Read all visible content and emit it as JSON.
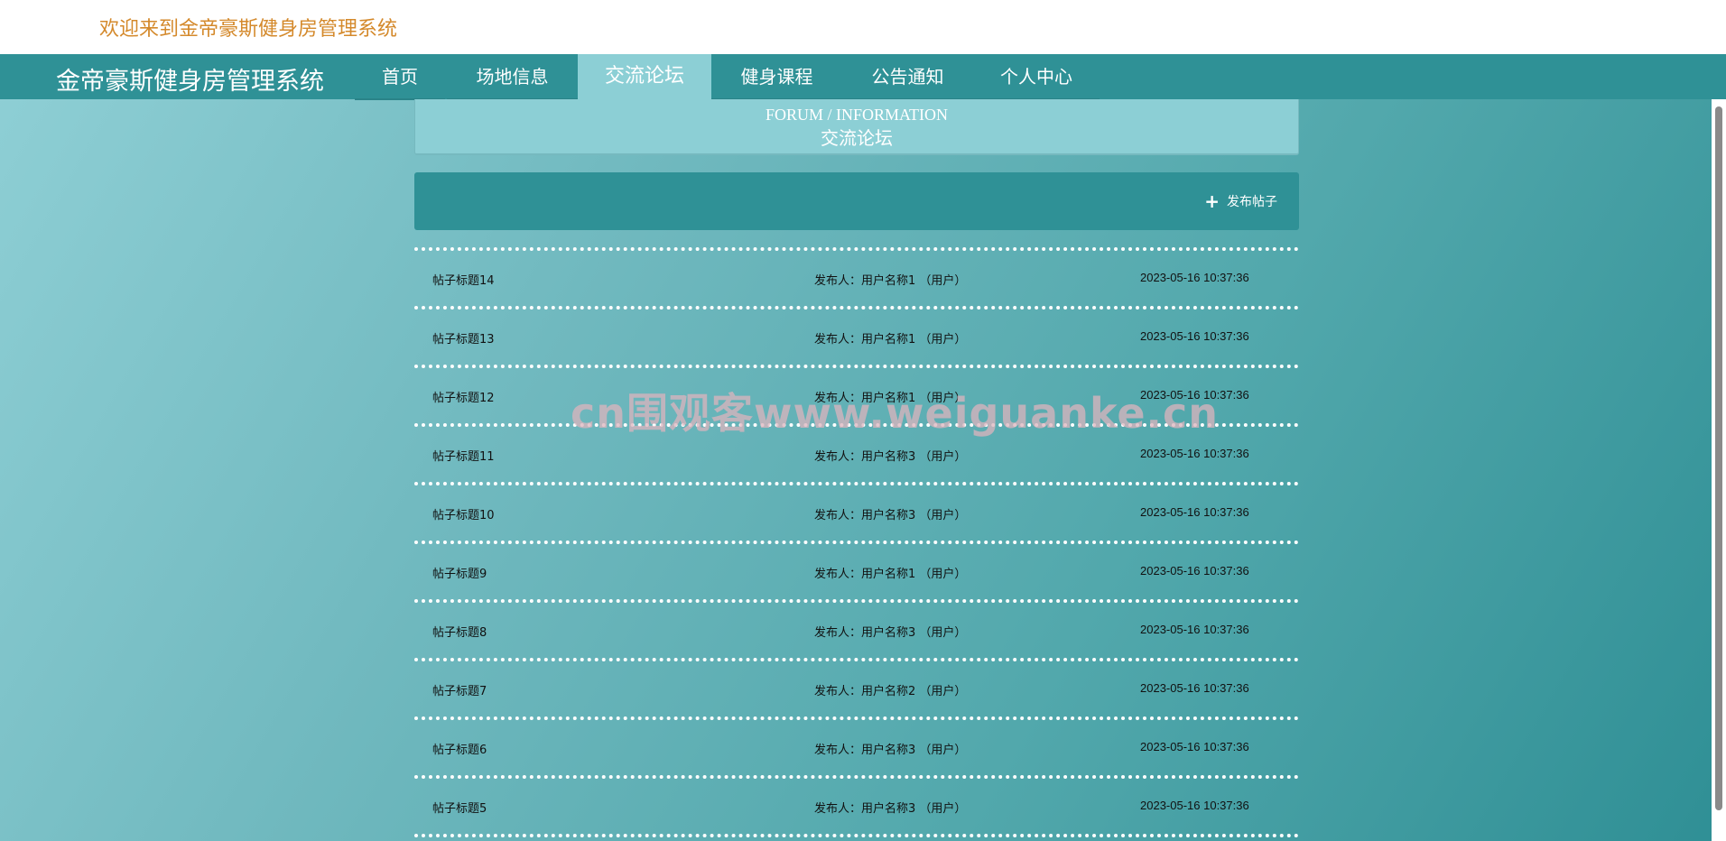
{
  "header": {
    "welcome": "欢迎来到金帝豪斯健身房管理系统"
  },
  "nav": {
    "brand": "金帝豪斯健身房管理系统",
    "items": [
      {
        "label": "首页"
      },
      {
        "label": "场地信息"
      },
      {
        "label": "交流论坛",
        "active": true
      },
      {
        "label": "健身课程"
      },
      {
        "label": "公告通知"
      },
      {
        "label": "个人中心"
      }
    ]
  },
  "forum": {
    "title_en": "FORUM / INFORMATION",
    "title_cn": "交流论坛",
    "post_button_label": "发布帖子",
    "posts": [
      {
        "title": "帖子标题14",
        "author": "发布人：用户名称1 （用户）",
        "time": "2023-05-16 10:37:36"
      },
      {
        "title": "帖子标题13",
        "author": "发布人：用户名称1 （用户）",
        "time": "2023-05-16 10:37:36"
      },
      {
        "title": "帖子标题12",
        "author": "发布人：用户名称1 （用户）",
        "time": "2023-05-16 10:37:36"
      },
      {
        "title": "帖子标题11",
        "author": "发布人：用户名称3 （用户）",
        "time": "2023-05-16 10:37:36"
      },
      {
        "title": "帖子标题10",
        "author": "发布人：用户名称3 （用户）",
        "time": "2023-05-16 10:37:36"
      },
      {
        "title": "帖子标题9",
        "author": "发布人：用户名称1 （用户）",
        "time": "2023-05-16 10:37:36"
      },
      {
        "title": "帖子标题8",
        "author": "发布人：用户名称3 （用户）",
        "time": "2023-05-16 10:37:36"
      },
      {
        "title": "帖子标题7",
        "author": "发布人：用户名称2 （用户）",
        "time": "2023-05-16 10:37:36"
      },
      {
        "title": "帖子标题6",
        "author": "发布人：用户名称3 （用户）",
        "time": "2023-05-16 10:37:36"
      },
      {
        "title": "帖子标题5",
        "author": "发布人：用户名称3 （用户）",
        "time": "2023-05-16 10:37:36"
      }
    ]
  },
  "watermark": "cn围观客www.weiguanke.cn",
  "colors": {
    "accent": "#2f9196",
    "active_tab": "#8ccfd5",
    "welcome_text": "#d4892b"
  }
}
